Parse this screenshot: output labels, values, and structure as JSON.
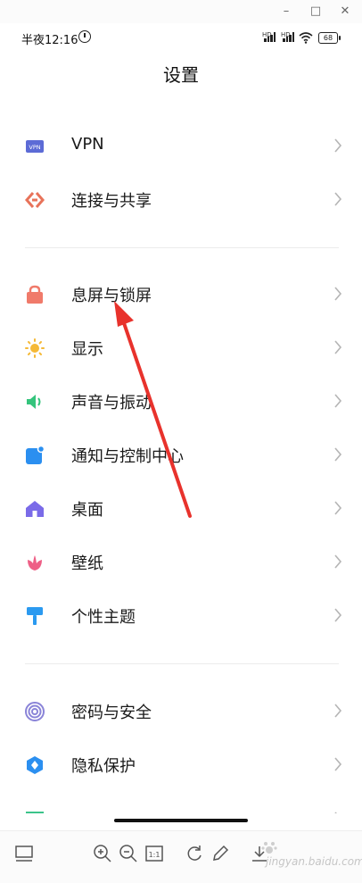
{
  "window": {
    "minimize": "–",
    "maximize": "□",
    "close": "✕"
  },
  "status_bar": {
    "time": "半夜12:16",
    "hd1": "HD",
    "hd2": "HD",
    "battery": "68"
  },
  "page": {
    "title": "设置",
    "cut_item": ""
  },
  "items": [
    {
      "label": "VPN",
      "icon": "vpn-icon",
      "color": "#5c6bd6"
    },
    {
      "label": "连接与共享",
      "icon": "connection-share-icon",
      "color": "#e8735a"
    },
    {
      "label": "息屏与锁屏",
      "icon": "lock-icon",
      "color": "#f07a6a"
    },
    {
      "label": "显示",
      "icon": "sun-icon",
      "color": "#f5b937"
    },
    {
      "label": "声音与振动",
      "icon": "speaker-icon",
      "color": "#34c47c"
    },
    {
      "label": "通知与控制中心",
      "icon": "notification-icon",
      "color": "#2b8ff0"
    },
    {
      "label": "桌面",
      "icon": "home-icon",
      "color": "#7a6be8"
    },
    {
      "label": "壁纸",
      "icon": "flower-icon",
      "color": "#ee5f86"
    },
    {
      "label": "个性主题",
      "icon": "brush-icon",
      "color": "#2b9af0"
    },
    {
      "label": "密码与安全",
      "icon": "fingerprint-icon",
      "color": "#8a84d8"
    },
    {
      "label": "隐私保护",
      "icon": "privacy-shield-icon",
      "color": "#2b8ff0"
    }
  ],
  "watermark": {
    "text": "jingyan.baidu.com"
  },
  "colors": {
    "annotation_arrow": "#e8322c",
    "chevron": "#b5b5b5"
  }
}
